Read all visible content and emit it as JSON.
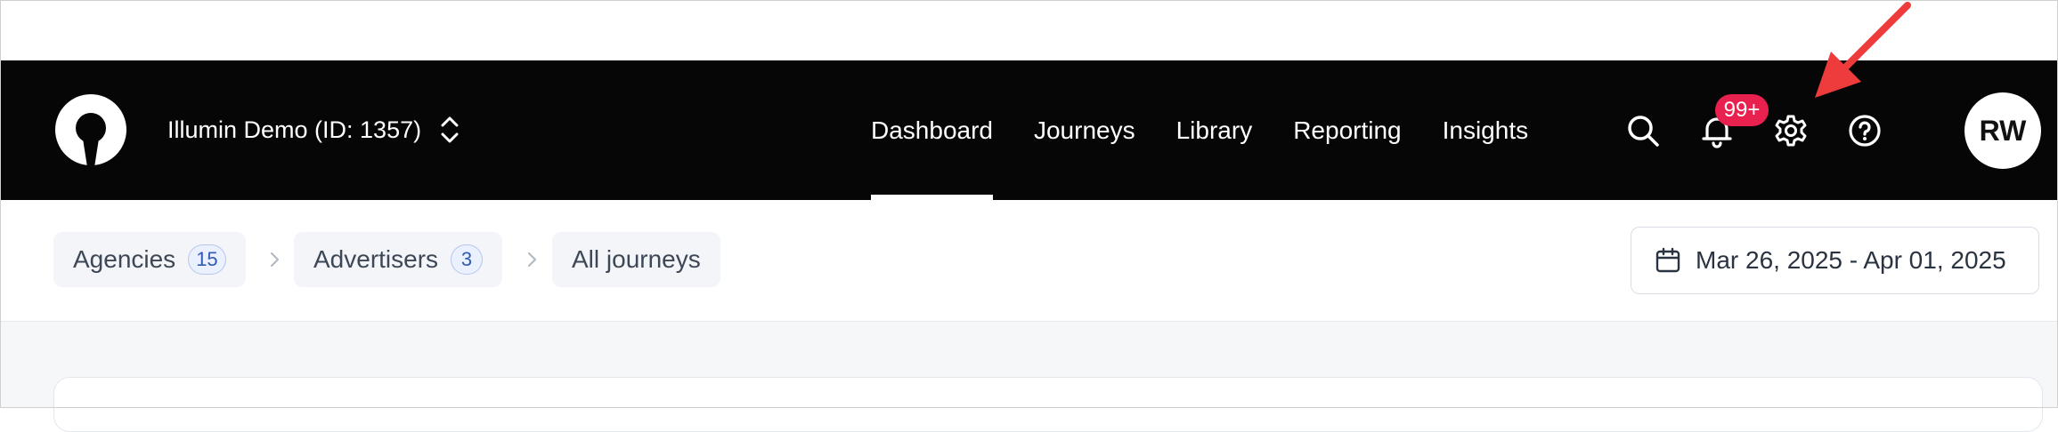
{
  "header": {
    "workspace_name": "Illumin Demo (ID: 1357)",
    "nav_tabs": [
      {
        "label": "Dashboard",
        "active": true
      },
      {
        "label": "Journeys",
        "active": false
      },
      {
        "label": "Library",
        "active": false
      },
      {
        "label": "Reporting",
        "active": false
      },
      {
        "label": "Insights",
        "active": false
      }
    ],
    "notifications_badge": "99+",
    "avatar_initials": "RW"
  },
  "breadcrumb": {
    "items": [
      {
        "label": "Agencies",
        "count": "15"
      },
      {
        "label": "Advertisers",
        "count": "3"
      },
      {
        "label": "All journeys"
      }
    ]
  },
  "date_range": "Mar 26, 2025 - Apr 01, 2025",
  "icons": {
    "logo": "illumin-logo",
    "search": "search-icon",
    "notifications": "bell-icon",
    "settings": "gear-icon",
    "help": "help-circle-icon",
    "calendar": "calendar-icon",
    "workspace_switcher": "chevron-up-down-icon",
    "annotation": "red-arrow-pointing-to-settings"
  },
  "colors": {
    "navbar_bg": "#060606",
    "badge": "#e8214f",
    "count_pill_text": "#2f5bb5",
    "annotation_arrow": "#ee3b3b"
  }
}
